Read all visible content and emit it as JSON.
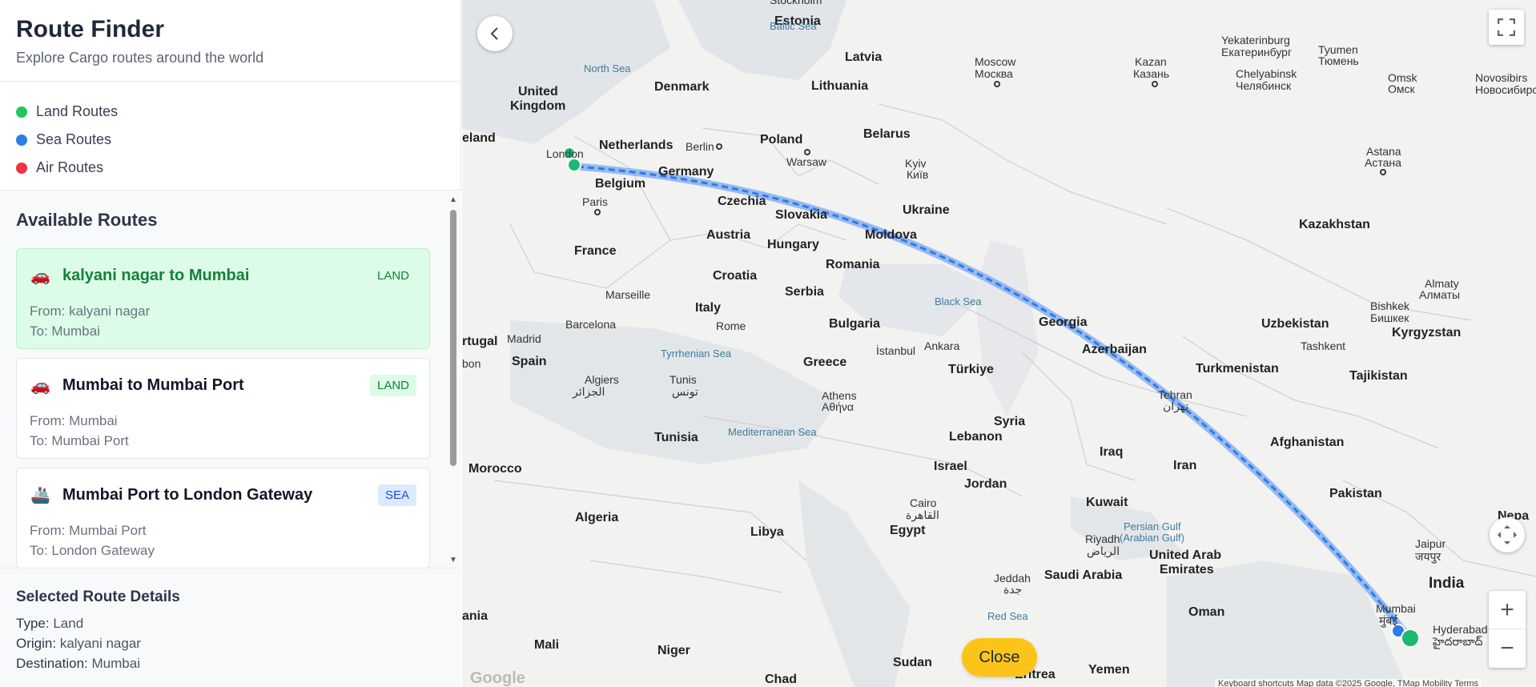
{
  "header": {
    "title": "Route Finder",
    "subtitle": "Explore Cargo routes around the world"
  },
  "legend": {
    "items": [
      {
        "label": "Land Routes",
        "color": "#22c55e"
      },
      {
        "label": "Sea Routes",
        "color": "#2d7be8"
      },
      {
        "label": "Air Routes",
        "color": "#ef3340"
      }
    ]
  },
  "routes": {
    "title": "Available Routes",
    "items": [
      {
        "icon": "🚗",
        "name": "kalyani nagar to Mumbai",
        "badge": "LAND",
        "from": "From: kalyani nagar",
        "to": "To: Mumbai",
        "selected": true
      },
      {
        "icon": "🚗",
        "name": "Mumbai to Mumbai Port",
        "badge": "LAND",
        "from": "From: Mumbai",
        "to": "To: Mumbai Port",
        "selected": false
      },
      {
        "icon": "🚢",
        "name": "Mumbai Port to London Gateway",
        "badge": "SEA",
        "from": "From: Mumbai Port",
        "to": "To: London Gateway",
        "selected": false
      }
    ]
  },
  "details": {
    "title": "Selected Route Details",
    "type_key": "Type:",
    "type_value": "Land",
    "origin_key": "Origin:",
    "origin_value": "kalyani nagar",
    "dest_key": "Destination:",
    "dest_value": "Mumbai"
  },
  "map": {
    "close_label": "Close",
    "zoom_in": "+",
    "zoom_out": "−",
    "google_logo": "Google",
    "attribution": "Keyboard shortcuts    Map data ©2025 Google, TMap Mobility    Terms",
    "route_color": "#2d7be8",
    "labels": {
      "estonia": "Estonia",
      "latvia": "Latvia",
      "lithuania": "Lithuania",
      "denmark": "Denmark",
      "uk1": "United",
      "uk2": "Kingdom",
      "ireland": "eland",
      "netherlands": "Netherlands",
      "belgium": "Belgium",
      "germany": "Germany",
      "poland": "Poland",
      "belarus": "Belarus",
      "czechia": "Czechia",
      "slovakia": "Slovakia",
      "austria": "Austria",
      "hungary": "Hungary",
      "ukraine": "Ukraine",
      "moldova": "Moldova",
      "romania": "Romania",
      "france": "France",
      "croatia": "Croatia",
      "serbia": "Serbia",
      "italy": "Italy",
      "bulgaria": "Bulgaria",
      "greece": "Greece",
      "spain": "Spain",
      "portugal": "rtugal",
      "turkiye": "Türkiye",
      "georgia": "Georgia",
      "azerbaijan": "Azerbaijan",
      "kazakhstan": "Kazakhstan",
      "uzbekistan": "Uzbekistan",
      "kyrgyzstan": "Kyrgyzstan",
      "turkmenistan": "Turkmenistan",
      "tajikistan": "Tajikistan",
      "afghanistan": "Afghanistan",
      "pakistan": "Pakistan",
      "iran": "Iran",
      "iraq": "Iraq",
      "syria": "Syria",
      "lebanon": "Lebanon",
      "israel": "Israel",
      "jordan": "Jordan",
      "kuwait": "Kuwait",
      "saudi": "Saudi Arabia",
      "uae1": "United Arab",
      "uae2": "Emirates",
      "oman": "Oman",
      "yemen": "Yemen",
      "egypt": "Egypt",
      "libya": "Libya",
      "algeria": "Algeria",
      "tunisia": "Tunisia",
      "morocco": "Morocco",
      "mali": "Mali",
      "niger": "Niger",
      "chad": "Chad",
      "sudan": "Sudan",
      "mauritania": "ania",
      "eritrea": "Eritrea",
      "india": "India",
      "nepal": "Nepa",
      "north_sea": "North Sea",
      "baltic_sea": "Baltic Sea",
      "black_sea": "Black Sea",
      "tyrrhenian": "Tyrrhenian Sea",
      "mediterranean": "Mediterranean Sea",
      "red_sea": "Red Sea",
      "persian1": "Persian Gulf",
      "persian2": "(Arabian Gulf)",
      "london": "London",
      "paris": "Paris",
      "berlin": "Berlin",
      "warsaw": "Warsaw",
      "moscow1": "Moscow",
      "moscow2": "Москва",
      "kazan1": "Kazan",
      "kazan2": "Казань",
      "yekat1": "Yekaterinburg",
      "yekat2": "Екатеринбург",
      "tyumen1": "Tyumen",
      "tyumen2": "Тюмень",
      "chely1": "Chelyabinsk",
      "chely2": "Челябинск",
      "omsk1": "Omsk",
      "omsk2": "Омск",
      "novo1": "Novosibirs",
      "novo2": "Новосибирс",
      "astana1": "Astana",
      "astana2": "Астана",
      "almaty1": "Almaty",
      "almaty2": "Алматы",
      "bishkek1": "Bishkek",
      "bishkek2": "Бишкек",
      "tashkent": "Tashkent",
      "kyiv1": "Kyiv",
      "kyiv2": "Київ",
      "marseille": "Marseille",
      "barcelona": "Barcelona",
      "madrid": "Madrid",
      "lisbon": "bon",
      "rome": "Rome",
      "istanbul": "İstanbul",
      "ankara": "Ankara",
      "athens1": "Athens",
      "athens2": "Αθήνα",
      "algiers1": "Algiers",
      "algiers2": "الجزائر",
      "tunis1": "Tunis",
      "tunis2": "تونس",
      "cairo1": "Cairo",
      "cairo2": "القاهرة",
      "tehran1": "Tehran",
      "tehran2": "تهران",
      "riyadh1": "Riyadh",
      "riyadh2": "الرياض",
      "jeddah1": "Jeddah",
      "jeddah2": "جدة",
      "jaipur1": "Jaipur",
      "jaipur2": "जयपुर",
      "mumbai1": "Mumbai",
      "mumbai2": "मुंबई",
      "hyderabad1": "Hyderabad",
      "hyderabad2": "హైదరాబాద్",
      "stockholm": "Stockholm"
    }
  }
}
